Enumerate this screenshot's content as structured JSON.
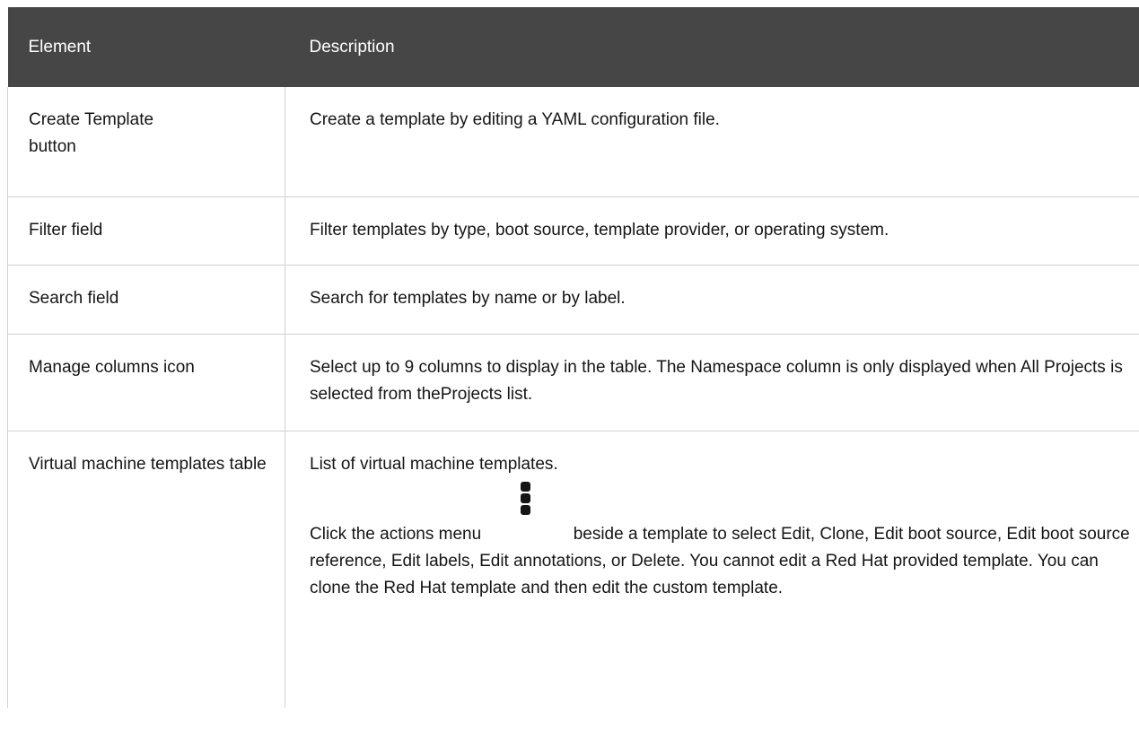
{
  "headers": {
    "element": "Element",
    "description": "Description"
  },
  "rows": [
    {
      "el_bold": "Create Template",
      "el_tail": "button",
      "desc": "Create a template by editing a YAML configuration file."
    },
    {
      "el_bold": "Filter",
      "el_tail": " field",
      "desc": "Filter templates by type, boot source, template provider, or operating system."
    },
    {
      "el_plain": "Search field",
      "desc": "Search for templates by name or by label."
    },
    {
      "el_bold": "Manage columns",
      "el_tail": " icon",
      "desc_parts": [
        "Select up to 9 columns to display in the table. The ",
        "Namespace",
        " column is only displayed when ",
        "All Projects",
        " is selected from the",
        "Projects",
        " list."
      ]
    },
    {
      "el_plain": "Virtual machine templates table",
      "desc_p1": "List of virtual machine templates.",
      "desc_p2_parts": [
        "Click the actions menu ",
        " beside a template to select ",
        "Edit",
        ", ",
        "Clone",
        ", ",
        "Edit boot source",
        ", ",
        "Edit boot source reference",
        ", ",
        "Edit labels",
        ", ",
        "Edit annotations",
        ", or ",
        "Delete",
        ". You cannot edit a Red Hat provided template. You can clone the Red Hat template and then edit the custom template."
      ],
      "icon": "kebab-menu-icon"
    }
  ],
  "colors": {
    "header_bg": "#464646",
    "header_text": "#ffffff",
    "border": "#d2d2d2",
    "text": "#151515"
  }
}
